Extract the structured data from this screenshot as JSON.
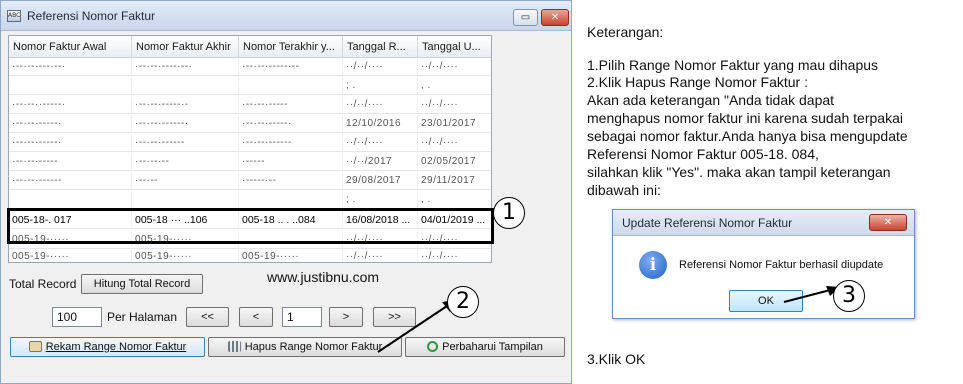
{
  "window": {
    "title": "Referensi Nomor Faktur",
    "icon_label": "ABC",
    "restore_glyph": "▭",
    "close_glyph": "✕"
  },
  "grid": {
    "columns": [
      "Nomor Faktur Awal",
      "Nomor Faktur Akhir",
      "Nomor Terakhir y...",
      "Tanggal R...",
      "Tanggal U..."
    ],
    "blurred_rows": [
      [
        "·--·--·---·--·",
        "·--·--·----·--·",
        "·--·--·-----·--",
        "··/··/····",
        "··/··/····"
      ],
      [
        "",
        "",
        "",
        "  ;       .",
        "  ,      ."
      ],
      [
        "·--·--··-----·",
        "·--·--·-----·-",
        "·--·--·-----",
        "··/··/····",
        "··/··/····"
      ],
      [
        "·--·--·-----·",
        "·--·--·------·",
        "·--·--·-----·",
        "12/10/2016",
        "23/01/2017"
      ],
      [
        "·--·--·-----·",
        "·--·--·------",
        "·--·--·------",
        "··/··/····",
        "··/··/····"
      ],
      [
        "·--·--·-----",
        "·--·--·--",
        "      ·-----",
        "··/··/2017",
        "02/05/2017"
      ],
      [
        "·--·--·------",
        "·--·--",
        "·-----·--",
        "29/08/2017",
        "29/11/2017"
      ],
      [
        "",
        "",
        "",
        "  ;       .",
        "  ,      ."
      ],
      [
        "·--·--·------",
        "·--·--·---·--",
        "·--·--·----",
        "··/··/····",
        "··/··/····"
      ]
    ],
    "selected_row": [
      "005-18-.    017",
      "005-18 ··· ..106",
      "005-18 .. . ..084",
      "16/08/2018 ...",
      "04/01/2019 ..."
    ],
    "after_rows": [
      [
        "005-19-·····",
        "005-19-·····",
        "",
        "··/··/····",
        "··/··/····"
      ],
      [
        "005-19-·····",
        "005-19-·····",
        "005-19-·····",
        "··/··/····",
        "··/··/····"
      ]
    ]
  },
  "callouts": [
    "1",
    "2",
    "3"
  ],
  "controls": {
    "total_record_label": "Total Record",
    "hitung_button": "Hitung Total Record",
    "watermark": "www.justibnu.com",
    "per_page_value": "100",
    "per_halaman_label": "Per Halaman",
    "first_button": "<<",
    "prev_button": "<",
    "page_value": "1",
    "next_button": ">",
    "last_button": ">>",
    "rekam_button": "Rekam Range Nomor Faktur",
    "hapus_button": "Hapus Range Nomor Faktur",
    "perbaharui_button": "Perbaharui Tampilan"
  },
  "notes": {
    "heading": "Keterangan:",
    "lines": [
      "1.Pilih Range Nomor Faktur yang mau dihapus",
      "2.Klik Hapus Range Nomor Faktur  :",
      "   Akan ada keterangan \"Anda tidak dapat",
      "menghapus nomor faktur ini karena sudah terpakai",
      "sebagai nomor faktur.Anda hanya bisa mengupdate",
      "Referensi Nomor Faktur 005-18.         084,",
      "silahkan klik \"Yes\". maka akan tampil keterangan",
      "dibawah ini:"
    ],
    "step3": "3.Klik OK"
  },
  "dialog": {
    "title": "Update Referensi Nomor Faktur",
    "close_glyph": "✕",
    "info_glyph": "i",
    "message": "Referensi Nomor Faktur berhasil diupdate",
    "ok_button": "OK"
  }
}
